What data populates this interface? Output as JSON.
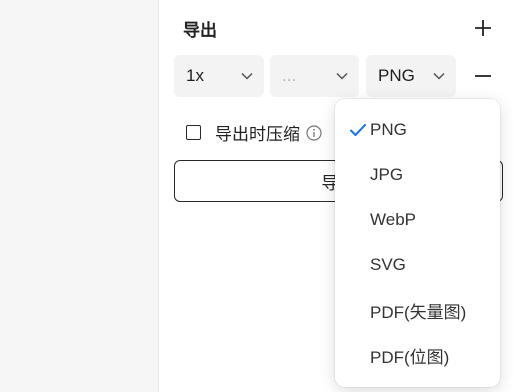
{
  "export": {
    "title": "导出",
    "scale": "1x",
    "suffix": "...",
    "format": "PNG",
    "compress_label": "导出时压缩",
    "export_button_label": "导出"
  },
  "dropdown": {
    "selected": "PNG",
    "options": [
      "PNG",
      "JPG",
      "WebP",
      "SVG",
      "PDF(矢量图)",
      "PDF(位图)"
    ]
  },
  "colors": {
    "accent": "#1a73e8",
    "select_bg": "#f3f3f3",
    "left_pane_bg": "#f6f6f6"
  }
}
